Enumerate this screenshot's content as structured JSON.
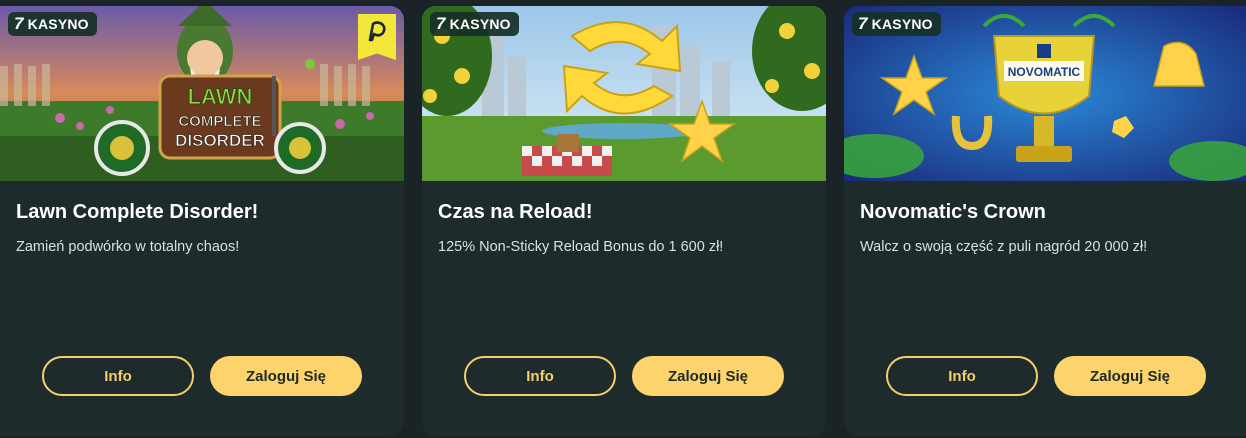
{
  "colors": {
    "page_bg": "#1a2427",
    "card_bg": "#1e2b2d",
    "accent": "#fdd36b",
    "tag_bg": "#163028",
    "text": "#ffffff",
    "muted_text": "#d9e0e0"
  },
  "cards": [
    {
      "tag": {
        "icon": "seven-logo-icon",
        "glyph": "7",
        "label": "KASYNO"
      },
      "banner_text": {
        "line1": "LAWN",
        "line2": "COMPLETE",
        "line3": "DISORDER"
      },
      "provider_badge_icon": "provider-badge-icon",
      "title": "Lawn Complete Disorder!",
      "description": "Zamień podwórko w totalny chaos!",
      "info_label": "Info",
      "login_label": "Zaloguj Się"
    },
    {
      "tag": {
        "icon": "seven-logo-icon",
        "glyph": "7",
        "label": "KASYNO"
      },
      "title": "Czas na Reload!",
      "description": "125% Non-Sticky Reload Bonus do 1 600 zł!",
      "info_label": "Info",
      "login_label": "Zaloguj Się"
    },
    {
      "tag": {
        "icon": "seven-logo-icon",
        "glyph": "7",
        "label": "KASYNO"
      },
      "banner_text": {
        "logo": "NOVOMATIC"
      },
      "title": "Novomatic's Crown",
      "description": "Walcz o swoją część z puli nagród 20 000 zł!",
      "info_label": "Info",
      "login_label": "Zaloguj Się"
    }
  ]
}
